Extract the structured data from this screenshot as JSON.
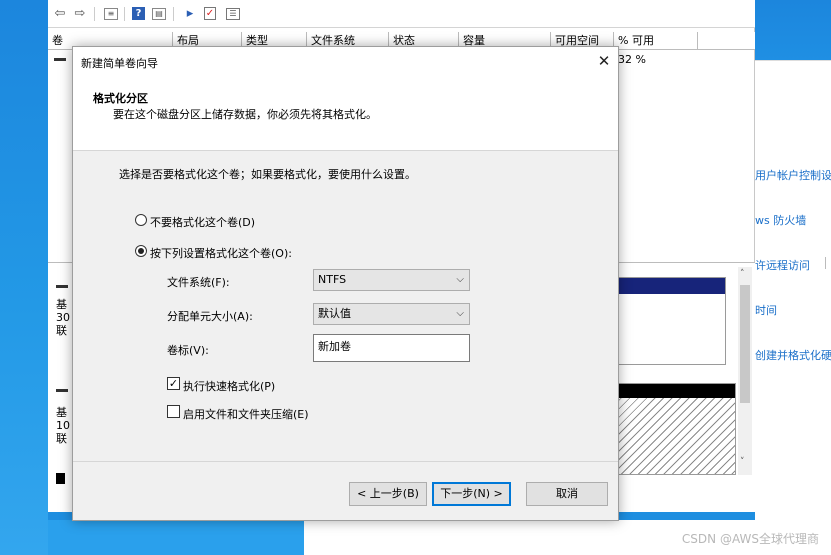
{
  "toolbar": {
    "icons": [
      "back-arrow-icon",
      "forward-arrow-icon",
      "console-tree-icon",
      "help-icon",
      "properties-icon",
      "rescan-disks-icon",
      "checklist-icon",
      "view-icon"
    ]
  },
  "volume_table": {
    "columns": [
      "卷",
      "布局",
      "类型",
      "文件系统",
      "状态",
      "容量",
      "可用空间",
      "% 可用"
    ],
    "row_fragment": "32 %"
  },
  "lower_disks": [
    {
      "line1": "基",
      "line2": "30",
      "line3": "联"
    },
    {
      "line1": "基",
      "line2": "10",
      "line3": "联"
    }
  ],
  "right_panel": {
    "items": [
      "用户帐户控制设",
      "ws 防火墙",
      "许远程访问",
      "时间",
      "创建并格式化硬"
    ]
  },
  "wizard": {
    "title": "新建简单卷向导",
    "heading": "格式化分区",
    "description": "要在这个磁盘分区上储存数据，你必须先将其格式化。",
    "prompt": "选择是否要格式化这个卷；如果要格式化，要使用什么设置。",
    "option_no_format": "不要格式化这个卷(D)",
    "option_format": "按下列设置格式化这个卷(O):",
    "filesystem_label": "文件系统(F):",
    "filesystem_value": "NTFS",
    "alloc_label": "分配单元大小(A):",
    "alloc_value": "默认值",
    "volume_label": "卷标(V):",
    "volume_value": "新加卷",
    "quick_format": "执行快速格式化(P)",
    "compression": "启用文件和文件夹压缩(E)",
    "back_button": "< 上一步(B)",
    "next_button": "下一步(N) >",
    "cancel_button": "取消"
  },
  "watermark": "CSDN @AWS全球代理商"
}
